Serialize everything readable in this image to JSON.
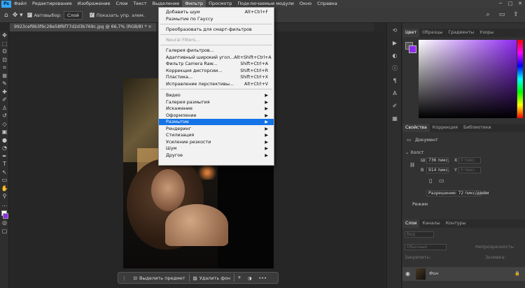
{
  "app": {
    "logo": "Ps"
  },
  "menubar": {
    "items": [
      "Файл",
      "Редактирование",
      "Изображение",
      "Слои",
      "Текст",
      "Выделение",
      "Фильтр",
      "Просмотр",
      "Подключаемые модули",
      "Окно",
      "Справка"
    ],
    "active_index": 6
  },
  "window_controls": [
    "─",
    "□",
    "✕"
  ],
  "options": {
    "autoselect_label": "Автовыбор:",
    "autoselect_value": "Слой",
    "show_controls_label": "Показать упр. элем."
  },
  "document": {
    "tab_title": "9923cef9b3f6c28e58f6f77d2d3b769c.jpg @ 66,7% (RGB/8) *"
  },
  "filter_menu": {
    "items": [
      {
        "label": "Добавить шум",
        "shortcut": "Alt+Ctrl+F"
      },
      {
        "label": "Размытие по Гауссу",
        "shortcut": ""
      },
      {
        "label": "Преобразовать для смарт-фильтров",
        "shortcut": ""
      },
      {
        "label": "Neural Filters...",
        "shortcut": "",
        "disabled": true
      },
      {
        "label": "Галерея фильтров...",
        "shortcut": ""
      },
      {
        "label": "Адаптивный широкий угол...",
        "shortcut": "Alt+Shift+Ctrl+A"
      },
      {
        "label": "Фильтр Camera Raw...",
        "shortcut": "Shift+Ctrl+A"
      },
      {
        "label": "Коррекция дисторсии...",
        "shortcut": "Shift+Ctrl+R"
      },
      {
        "label": "Пластика...",
        "shortcut": "Shift+Ctrl+X"
      },
      {
        "label": "Исправление перспективы...",
        "shortcut": "Alt+Ctrl+V"
      },
      {
        "label": "Видео",
        "submenu": true
      },
      {
        "label": "Галерея размытия",
        "submenu": true
      },
      {
        "label": "Искажение",
        "submenu": true
      },
      {
        "label": "Оформление",
        "submenu": true
      },
      {
        "label": "Размытие",
        "submenu": true,
        "highlighted": true
      },
      {
        "label": "Рендеринг",
        "submenu": true
      },
      {
        "label": "Стилизация",
        "submenu": true
      },
      {
        "label": "Усиление резкости",
        "submenu": true
      },
      {
        "label": "Шум",
        "submenu": true
      },
      {
        "label": "Другое",
        "submenu": true
      }
    ]
  },
  "context_bar": {
    "select_subject": "Выделить предмет",
    "remove_bg": "Удалить фон",
    "more": "•••"
  },
  "color_panel": {
    "tabs": [
      "Цвет",
      "Образцы",
      "Градиенты",
      "Узоры"
    ],
    "fg_color": "#555555",
    "bg_color": "#8e2bf0"
  },
  "properties_panel": {
    "tabs": [
      "Свойства",
      "Коррекция",
      "Библиотеки"
    ],
    "doc_label": "Документ",
    "canvas_label": "Холст",
    "w_label": "Ш",
    "w_value": "736 пикс.",
    "h_label": "В",
    "h_value": "914 пикс.",
    "x_label": "X",
    "x_placeholder": "0 пикс.",
    "y_label": "Y",
    "y_placeholder": "0 пикс.",
    "resolution": "Разрешение: 72 пикс/дюйм",
    "mode_label": "Режим"
  },
  "layers_panel": {
    "tabs": [
      "Слои",
      "Каналы",
      "Контуры"
    ],
    "kind_placeholder": "Вид",
    "blend_mode": "Обычные",
    "opacity_label": "Непрозрачность:",
    "lock_label": "Закрепить:",
    "fill_label": "Заливка:",
    "layer_name": "Фон"
  }
}
